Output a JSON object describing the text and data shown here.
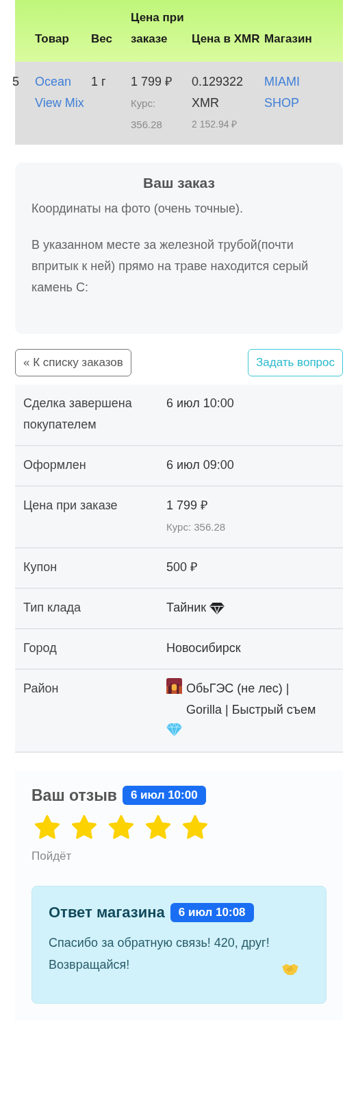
{
  "order_table": {
    "columns": [
      "Товар",
      "Вес",
      "Цена при заказе",
      "Цена в XMR",
      "Магазин"
    ],
    "rows": [
      {
        "column_1": "5",
        "product": "Ocean View Mix",
        "weight": "1 г",
        "price": "1 799 ₽",
        "price_rate": "Курс: 356.28",
        "price_xmr": "0.129322 XMR",
        "price_xmr_rub": "2 152.94 ₽",
        "shop": "MIAMI SHOP"
      }
    ]
  },
  "order_card": {
    "title": "Ваш заказ",
    "paragraphs": [
      "Координаты на фото (очень точные).",
      "В указанном месте за железной трубой(почти впритык к ней) прямо на траве находится серый камень С:"
    ]
  },
  "buttons": {
    "back": "« К списку заказов",
    "ask": "Задать вопрос"
  },
  "details": [
    {
      "kind": "plain",
      "label": "Сделка завершена покупателем",
      "value": "6 июл 10:00"
    },
    {
      "kind": "plain",
      "label": "Оформлен",
      "value": "6 июл 09:00"
    },
    {
      "kind": "note",
      "label": "Цена при заказе",
      "value": "1 799 ₽",
      "note": "Курс: 356.28"
    },
    {
      "kind": "plain",
      "label": "Купон",
      "value": "500 ₽"
    },
    {
      "kind": "stash",
      "label": "Тип клада",
      "value": "Тайник"
    },
    {
      "kind": "plain",
      "label": "Город",
      "value": "Новосибирск"
    },
    {
      "kind": "district",
      "label": "Район",
      "value": "ОбьГЭС (не лес) | Gorilla | Быстрый съем"
    }
  ],
  "review": {
    "title": "Ваш отзыв",
    "date": "6 июл 10:00",
    "stars": 5,
    "text": "Пойдёт"
  },
  "reply": {
    "title": "Ответ магазина",
    "date": "6 июл 10:08",
    "text": "Спасибо за обратную связь! 420, друг! Возвращайся!"
  }
}
